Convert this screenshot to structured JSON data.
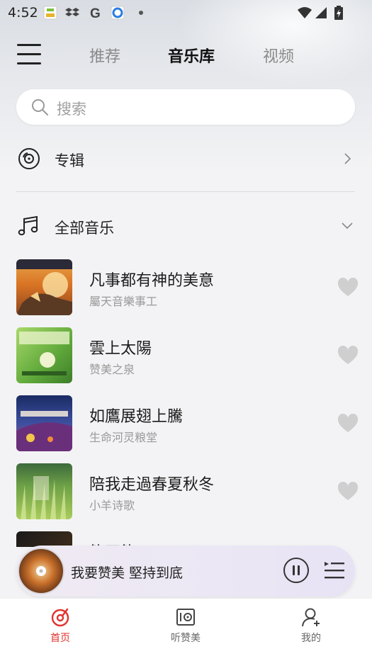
{
  "status_bar": {
    "time": "4:52",
    "icons": [
      "app-notification-icon",
      "dropbox-icon",
      "google-icon",
      "browser-icon",
      "wifi-icon",
      "signal-icon",
      "battery-icon"
    ]
  },
  "top_nav": {
    "tabs": [
      {
        "label": "推荐",
        "active": false
      },
      {
        "label": "音乐库",
        "active": true
      },
      {
        "label": "视频",
        "active": false
      }
    ]
  },
  "search": {
    "placeholder": "搜索"
  },
  "album_row": {
    "label": "专辑"
  },
  "all_music_row": {
    "label": "全部音乐"
  },
  "songs": [
    {
      "title": "凡事都有神的美意",
      "artist": "屬天音樂事工"
    },
    {
      "title": "雲上太陽",
      "artist": "赞美之泉"
    },
    {
      "title": "如鷹展翅上騰",
      "artist": "生命河灵粮堂"
    },
    {
      "title": "陪我走過春夏秋冬",
      "artist": "小羊诗歌"
    },
    {
      "title": "能不能",
      "artist": ""
    }
  ],
  "player": {
    "now_playing": "我要赞美 堅持到底"
  },
  "bottom_nav": {
    "items": [
      {
        "label": "首页",
        "active": true
      },
      {
        "label": "听赞美",
        "active": false
      },
      {
        "label": "我的",
        "active": false
      }
    ]
  },
  "colors": {
    "accent": "#e0322e",
    "heart": "#cfcfcf"
  }
}
